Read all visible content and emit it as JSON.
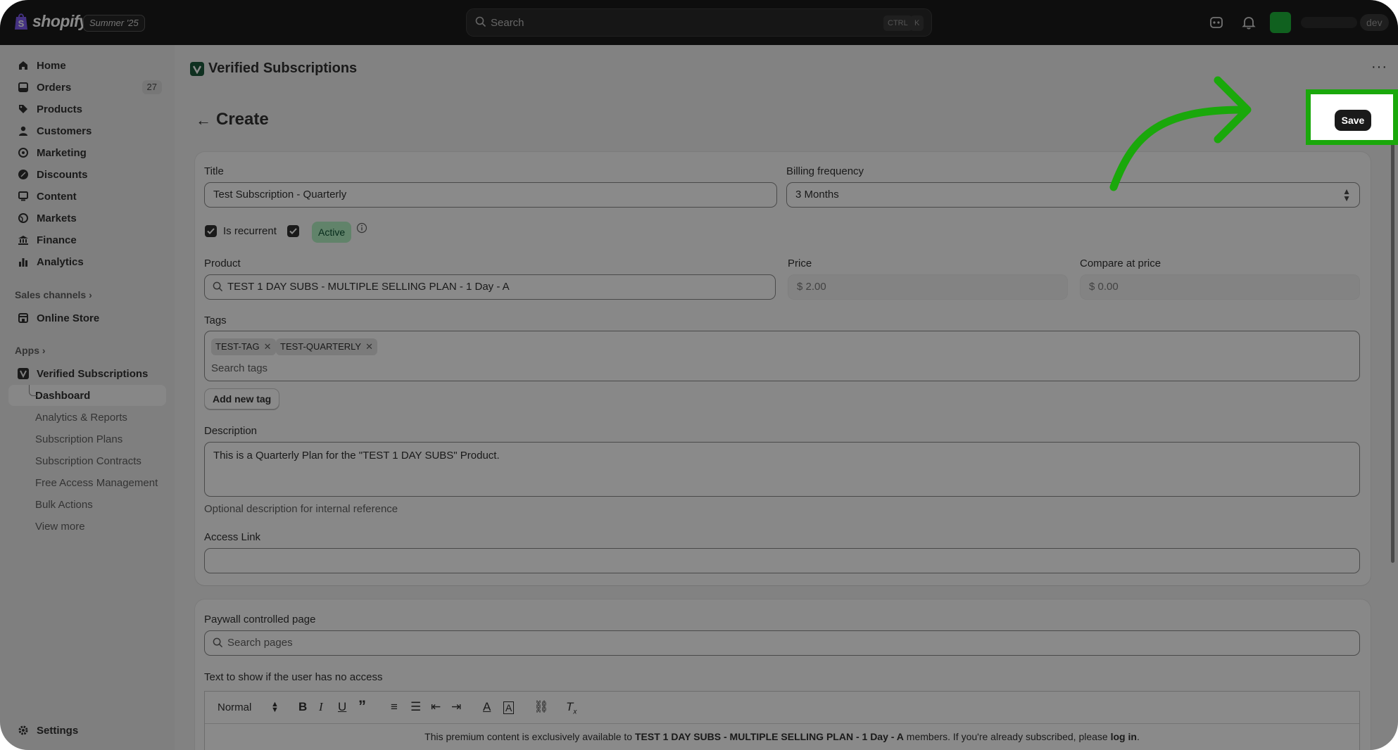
{
  "topbar": {
    "brand": "shopify",
    "edition": "Summer '25",
    "search_placeholder": "Search",
    "shortcut_ctrl": "CTRL",
    "shortcut_k": "K",
    "env_badge": "dev"
  },
  "sidebar": {
    "items": [
      {
        "label": "Home",
        "icon": "home-icon"
      },
      {
        "label": "Orders",
        "icon": "orders-icon",
        "count": "27"
      },
      {
        "label": "Products",
        "icon": "tag-icon"
      },
      {
        "label": "Customers",
        "icon": "person-icon"
      },
      {
        "label": "Marketing",
        "icon": "target-icon"
      },
      {
        "label": "Discounts",
        "icon": "discount-icon"
      },
      {
        "label": "Content",
        "icon": "content-icon"
      },
      {
        "label": "Markets",
        "icon": "globe-icon"
      },
      {
        "label": "Finance",
        "icon": "bank-icon"
      },
      {
        "label": "Analytics",
        "icon": "bar-chart-icon"
      }
    ],
    "sales_channels_label": "Sales channels",
    "online_store_label": "Online Store",
    "apps_label": "Apps",
    "app_name": "Verified Subscriptions",
    "app_subitems": [
      "Dashboard",
      "Analytics & Reports",
      "Subscription Plans",
      "Subscription Contracts",
      "Free Access Management",
      "Bulk Actions",
      "View more"
    ],
    "settings_label": "Settings"
  },
  "main": {
    "app_title": "Verified Subscriptions",
    "more_label": "···",
    "page_title": "Create",
    "save_label": "Save",
    "form": {
      "title_label": "Title",
      "title_value": "Test Subscription - Quarterly",
      "billing_label": "Billing frequency",
      "billing_value": "3 Months",
      "recurrent_label": "Is recurrent",
      "active_badge": "Active",
      "product_label": "Product",
      "product_value": "TEST 1 DAY SUBS - MULTIPLE SELLING PLAN - 1 Day - A",
      "price_label": "Price",
      "price_value": "$ 2.00",
      "compare_label": "Compare at price",
      "compare_value": "$ 0.00",
      "tags_label": "Tags",
      "tags": [
        "TEST-TAG",
        "TEST-QUARTERLY"
      ],
      "tags_search_placeholder": "Search tags",
      "add_tag_label": "Add new tag",
      "description_label": "Description",
      "description_value": "This is a Quarterly Plan for the \"TEST 1 DAY SUBS\" Product.",
      "description_help": "Optional description for internal reference",
      "access_link_label": "Access Link",
      "access_link_value": ""
    },
    "paywall": {
      "page_label": "Paywall controlled page",
      "page_search_placeholder": "Search pages",
      "no_access_label": "Text to show if the user has no access",
      "editor_style": "Normal",
      "editor_text_prefix": "This premium content is exclusively available to ",
      "editor_text_product": "TEST 1 DAY SUBS - MULTIPLE SELLING PLAN - 1 Day - A",
      "editor_text_middle": " members. If you're already subscribed, please ",
      "editor_text_link": "log in",
      "editor_text_suffix": "."
    }
  },
  "colors": {
    "highlight": "#1aa80b",
    "topbar": "#1a1a1a",
    "active_badge_bg": "#b4f3c4"
  }
}
